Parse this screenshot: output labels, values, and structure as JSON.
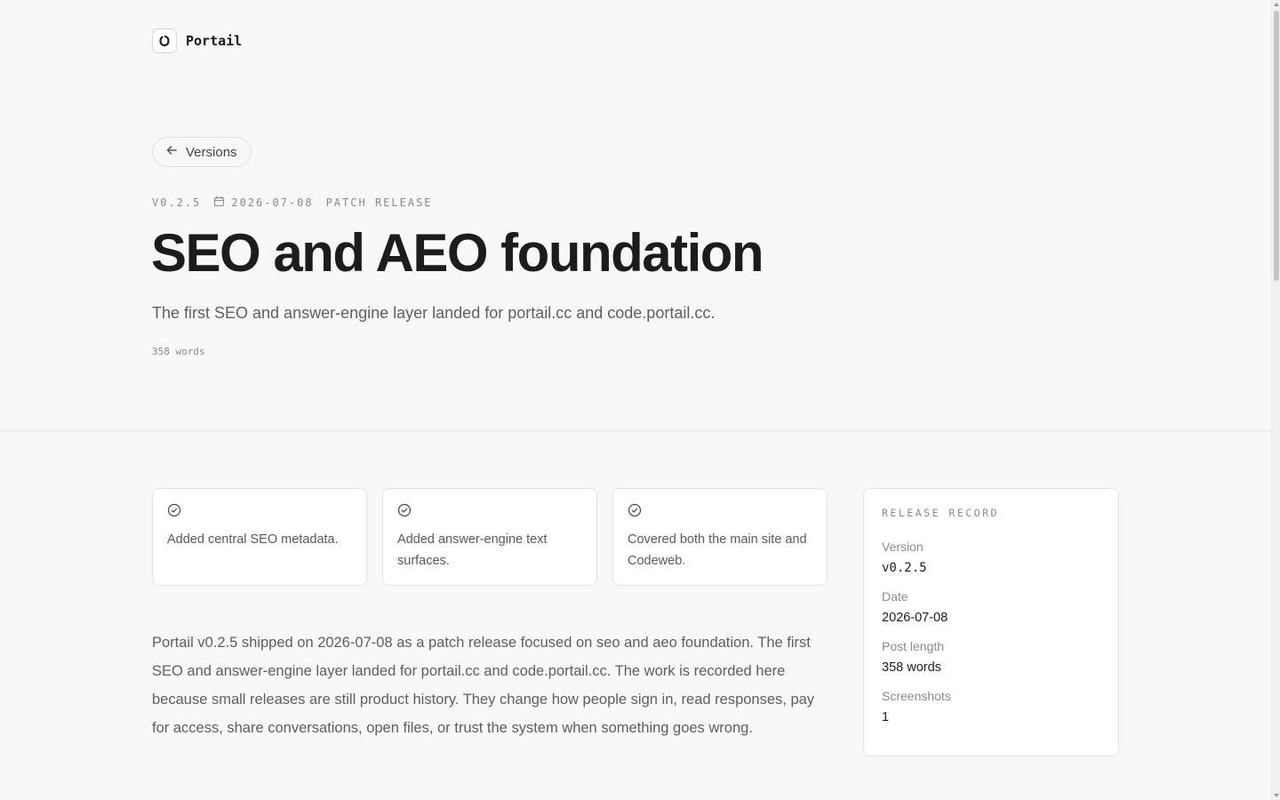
{
  "brand": {
    "name": "Portail"
  },
  "nav": {
    "back_label": "Versions"
  },
  "release": {
    "version_tag": "V0.2.5",
    "date": "2026-07-08",
    "type": "PATCH RELEASE",
    "title": "SEO and AEO foundation",
    "subtitle": "The first SEO and answer-engine layer landed for portail.cc and code.portail.cc.",
    "word_count": "358 words"
  },
  "highlights": [
    {
      "icon": "check-circle-icon",
      "text": "Added central SEO metadata."
    },
    {
      "icon": "check-circle-icon",
      "text": "Added answer-engine text surfaces."
    },
    {
      "icon": "check-circle-icon",
      "text": "Covered both the main site and Codeweb."
    }
  ],
  "body": "Portail v0.2.5 shipped on 2026-07-08 as a patch release focused on seo and aeo foundation. The first SEO and answer-engine layer landed for portail.cc and code.portail.cc. The work is recorded here because small releases are still product history. They change how people sign in, read responses, pay for access, share conversations, open files, or trust the system when something goes wrong.",
  "record": {
    "heading": "RELEASE RECORD",
    "rows": [
      {
        "label": "Version",
        "value": "v0.2.5"
      },
      {
        "label": "Date",
        "value": "2026-07-08"
      },
      {
        "label": "Post length",
        "value": "358 words"
      },
      {
        "label": "Screenshots",
        "value": "1"
      }
    ]
  },
  "colors": {
    "background": "#f8f8f8",
    "text": "#1c1c1c",
    "muted": "#8a8a8a",
    "border": "#e2e2e2"
  }
}
